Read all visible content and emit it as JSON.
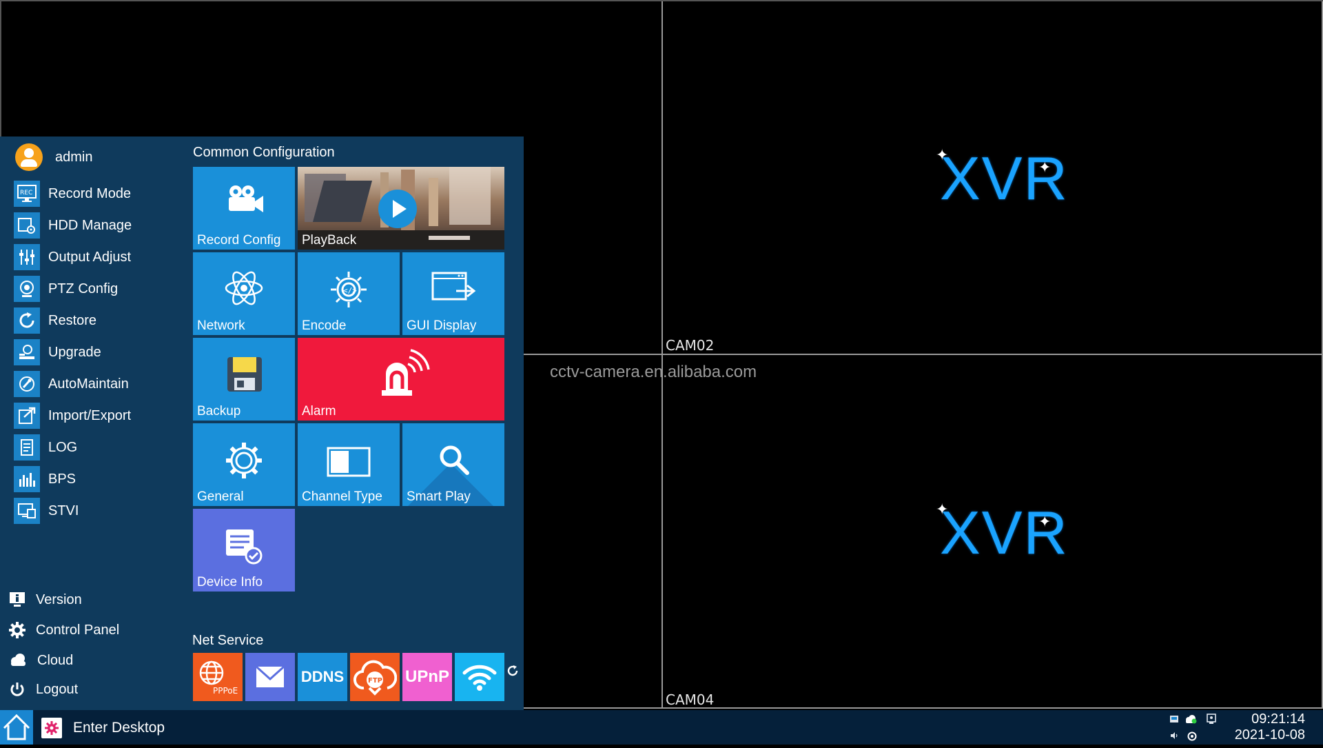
{
  "cameras": [
    {
      "label": "",
      "has_logo": false
    },
    {
      "label": "CAM02",
      "logo": "XVR"
    },
    {
      "label": "",
      "has_logo": false
    },
    {
      "label": "CAM04",
      "logo": "XVR"
    }
  ],
  "watermark": "cctv-camera.en.alibaba.com",
  "user": {
    "name": "admin"
  },
  "sidebar": {
    "items": [
      {
        "label": "Record Mode",
        "icon": "rec-monitor-icon"
      },
      {
        "label": "HDD Manage",
        "icon": "hdd-gear-icon"
      },
      {
        "label": "Output Adjust",
        "icon": "sliders-icon"
      },
      {
        "label": "PTZ Config",
        "icon": "ptz-camera-icon"
      },
      {
        "label": "Restore",
        "icon": "restore-icon"
      },
      {
        "label": "Upgrade",
        "icon": "upgrade-icon"
      },
      {
        "label": "AutoMaintain",
        "icon": "auto-maintain-icon"
      },
      {
        "label": "Import/Export",
        "icon": "import-export-icon"
      },
      {
        "label": "LOG",
        "icon": "log-icon"
      },
      {
        "label": "BPS",
        "icon": "bps-bars-icon"
      },
      {
        "label": "STVI",
        "icon": "stvi-monitor-icon"
      }
    ],
    "bottom": [
      {
        "label": "Version",
        "icon": "info-icon"
      },
      {
        "label": "Control Panel",
        "icon": "gear-icon"
      },
      {
        "label": "Cloud",
        "icon": "cloud-icon"
      },
      {
        "label": "Logout",
        "icon": "power-icon"
      }
    ]
  },
  "common": {
    "title": "Common Configuration",
    "tiles": {
      "record_config": "Record Config",
      "playback": "PlayBack",
      "network": "Network",
      "encode": "Encode",
      "gui_display": "GUI Display",
      "backup": "Backup",
      "alarm": "Alarm",
      "general": "General",
      "channel_type": "Channel Type",
      "smart_play": "Smart Play",
      "device_info": "Device Info"
    }
  },
  "net_service": {
    "title": "Net Service",
    "items": [
      {
        "label": "PPPoE",
        "color": "#f05a1e"
      },
      {
        "label": "",
        "icon": "email-icon",
        "color": "#5b6fe0"
      },
      {
        "label": "DDNS",
        "color": "#1a90d9"
      },
      {
        "label": "FTP",
        "color": "#f05a1e"
      },
      {
        "label": "UPnP",
        "color": "#f060d0"
      },
      {
        "label": "",
        "icon": "wifi-icon",
        "color": "#18b4f0"
      }
    ]
  },
  "taskbar": {
    "enter_desktop": "Enter Desktop",
    "time": "09:21:14",
    "date": "2021-10-08"
  },
  "colors": {
    "menu_bg": "#0f3a5c",
    "tile_blue": "#1a90d9",
    "alarm_red": "#f0193c",
    "taskbar": "#05203a"
  }
}
